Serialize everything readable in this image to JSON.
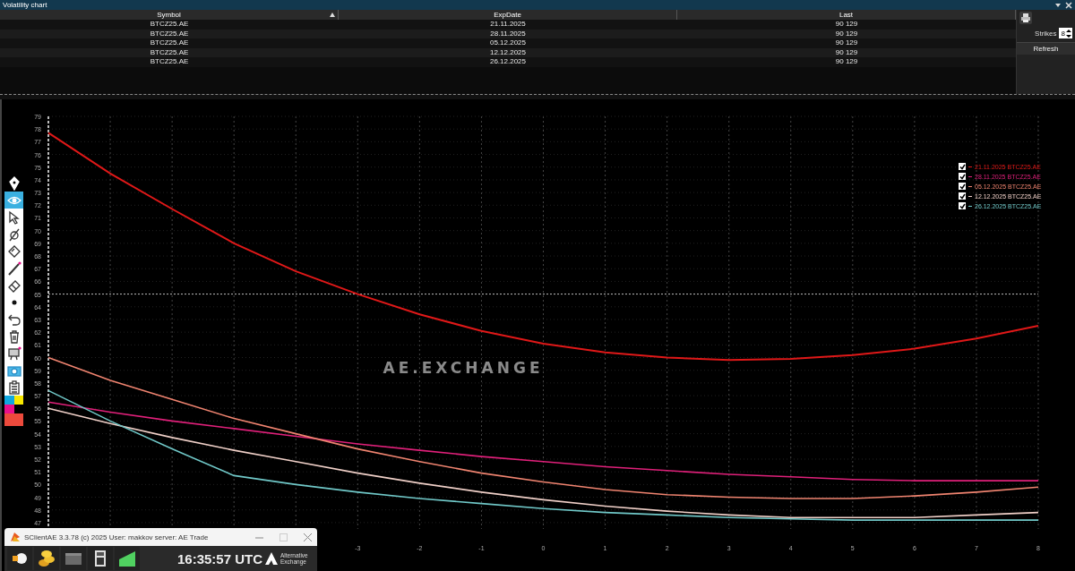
{
  "window": {
    "title": "Volatility chart"
  },
  "table": {
    "columns": [
      {
        "label": "Symbol",
        "sorted": true
      },
      {
        "label": "ExpDate",
        "sorted": false
      },
      {
        "label": "Last",
        "sorted": false
      }
    ],
    "rows": [
      [
        "BTCZ25.AE",
        "21.11.2025",
        "90 129"
      ],
      [
        "BTCZ25.AE",
        "28.11.2025",
        "90 129"
      ],
      [
        "BTCZ25.AE",
        "05.12.2025",
        "90 129"
      ],
      [
        "BTCZ25.AE",
        "12.12.2025",
        "90 129"
      ],
      [
        "BTCZ25.AE",
        "26.12.2025",
        "90 129"
      ]
    ]
  },
  "side_panel": {
    "strikes_label": "Strikes",
    "strikes_value": "8",
    "refresh": "Refresh"
  },
  "toolbar": {
    "tools": [
      {
        "kind": "pen",
        "selected": false
      },
      {
        "kind": "eye",
        "selected": true
      },
      {
        "kind": "pointer",
        "selected": false
      },
      {
        "kind": "crossed",
        "selected": false
      },
      {
        "kind": "tag",
        "selected": false
      },
      {
        "kind": "line",
        "selected": false
      },
      {
        "kind": "eraser",
        "selected": false
      },
      {
        "kind": "dot",
        "selected": false
      },
      {
        "kind": "undo",
        "selected": false
      },
      {
        "kind": "trash",
        "selected": false
      },
      {
        "kind": "easel",
        "selected": false
      },
      {
        "kind": "camera",
        "selected": false
      },
      {
        "kind": "clipboard",
        "selected": false
      }
    ],
    "palette": [
      {
        "color": "#10a8e0"
      },
      {
        "color": "#f8e800"
      },
      {
        "color": "#e8108a"
      },
      {
        "color": "#000000"
      },
      {
        "color": "#ec4a3c"
      }
    ]
  },
  "chart": {
    "watermark": "AE.EXCHANGE",
    "legend": [
      {
        "checked": true
      },
      {
        "checked": true
      },
      {
        "checked": true
      },
      {
        "checked": true
      },
      {
        "checked": true
      }
    ],
    "chart_data": {
      "type": "line",
      "x": [
        -8,
        -7,
        -6,
        -5,
        -4,
        -3,
        -2,
        -1,
        0,
        1,
        2,
        3,
        4,
        5,
        6,
        7,
        8
      ],
      "xlim": [
        -8,
        8
      ],
      "ylim": [
        46.5,
        79
      ],
      "xticks": [
        -3,
        -2,
        -1,
        0,
        1,
        2,
        3,
        4,
        5,
        6,
        7,
        8
      ],
      "yticks": [
        47,
        48,
        49,
        50,
        51,
        52,
        53,
        54,
        55,
        56,
        57,
        58,
        59,
        60,
        61,
        62,
        63,
        64,
        65,
        66,
        67,
        68,
        69,
        70,
        71,
        72,
        73,
        74,
        75,
        76,
        77,
        78,
        79
      ],
      "series": [
        {
          "name": "21.11.2025 BTCZ25.AE",
          "color": "#e01818",
          "values": [
            77.7,
            74.5,
            71.7,
            69.0,
            66.8,
            65.0,
            63.4,
            62.1,
            61.1,
            60.4,
            60.0,
            59.8,
            59.9,
            60.2,
            60.7,
            61.5,
            62.5
          ]
        },
        {
          "name": "28.11.2025 BTCZ25.AE",
          "color": "#e0207a",
          "values": [
            56.5,
            55.7,
            55.0,
            54.4,
            53.8,
            53.2,
            52.7,
            52.2,
            51.8,
            51.4,
            51.1,
            50.8,
            50.6,
            50.4,
            50.3,
            50.3,
            50.3
          ]
        },
        {
          "name": "05.12.2025 BTCZ25.AE",
          "color": "#f08470",
          "values": [
            60.0,
            58.2,
            56.7,
            55.2,
            54.0,
            52.8,
            51.8,
            50.9,
            50.2,
            49.6,
            49.2,
            49.0,
            48.9,
            48.9,
            49.1,
            49.4,
            49.8
          ]
        },
        {
          "name": "12.12.2025 BTCZ25.AE",
          "color": "#f0d0c8",
          "values": [
            56.0,
            54.8,
            53.7,
            52.7,
            51.8,
            50.9,
            50.1,
            49.4,
            48.8,
            48.3,
            47.9,
            47.6,
            47.4,
            47.4,
            47.4,
            47.6,
            47.8
          ]
        },
        {
          "name": "26.12.2025 BTCZ25.AE",
          "color": "#70c8c8",
          "values": [
            57.4,
            55.0,
            52.8,
            50.7,
            50.0,
            49.4,
            48.9,
            48.5,
            48.1,
            47.8,
            47.6,
            47.4,
            47.3,
            47.2,
            47.2,
            47.2,
            47.2
          ]
        }
      ],
      "grid": true,
      "legend": true,
      "ref_lines": [
        {
          "axis": "y",
          "value": 65
        }
      ]
    }
  },
  "client_window": {
    "title": "SClientAE 3.3.78 (c) 2025 User: makkov server: AE Trade",
    "clock": "16:35:57 UTC",
    "logo_text": "Alternative Exchange",
    "apps": [
      {
        "kind": "plug"
      },
      {
        "kind": "coins"
      },
      {
        "kind": "wallet"
      },
      {
        "kind": "calculator"
      },
      {
        "kind": "chart"
      }
    ]
  }
}
